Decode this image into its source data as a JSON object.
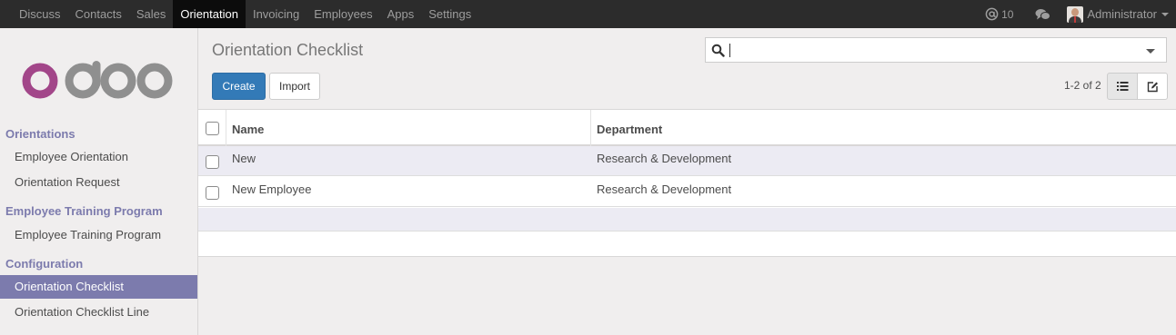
{
  "topbar": {
    "menu": [
      "Discuss",
      "Contacts",
      "Sales",
      "Orientation",
      "Invoicing",
      "Employees",
      "Apps",
      "Settings"
    ],
    "active": "Orientation",
    "messages_count": "10",
    "user": "Administrator"
  },
  "sidebar": {
    "logo_text": "odoo",
    "sections": [
      {
        "title": "Orientations",
        "items": [
          "Employee Orientation",
          "Orientation Request"
        ]
      },
      {
        "title": "Employee Training Program",
        "items": [
          "Employee Training Program"
        ]
      },
      {
        "title": "Configuration",
        "items": [
          "Orientation Checklist",
          "Orientation Checklist Line"
        ]
      }
    ],
    "active_item": "Orientation Checklist"
  },
  "control": {
    "title": "Orientation Checklist",
    "search_value": "",
    "create_label": "Create",
    "import_label": "Import",
    "pager": "1-2 of 2"
  },
  "table": {
    "columns": [
      "Name",
      "Department"
    ],
    "rows": [
      {
        "name": "New",
        "department": "Research & Development"
      },
      {
        "name": "New Employee",
        "department": "Research & Development"
      }
    ]
  },
  "colors": {
    "navbar": "#2c2c2c",
    "accent": "#7c7bad",
    "primary_button": "#337ab7"
  }
}
